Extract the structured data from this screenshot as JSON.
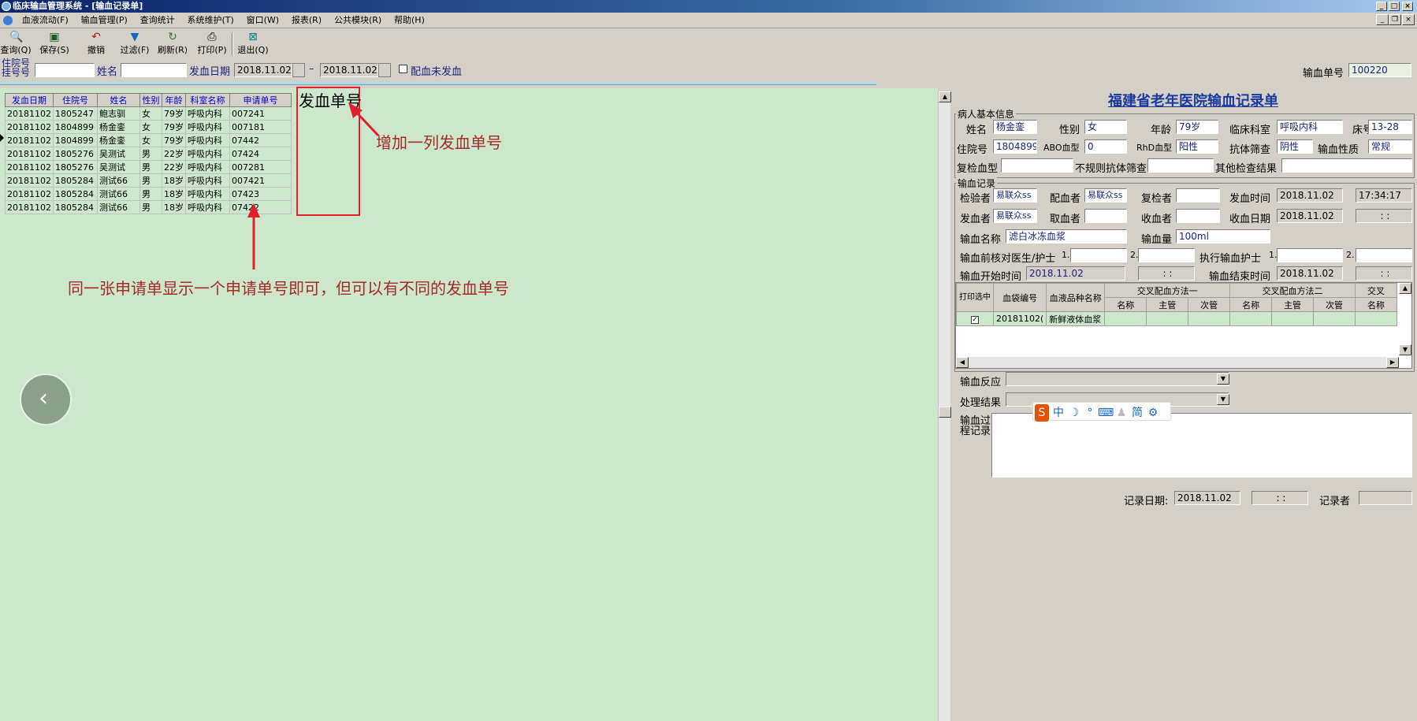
{
  "window": {
    "title": "临床输血管理系统 - [输血记录单]"
  },
  "menu": [
    "血液流动(F)",
    "输血管理(P)",
    "查询统计",
    "系统维护(T)",
    "窗口(W)",
    "报表(R)",
    "公共模块(R)",
    "帮助(H)"
  ],
  "toolbar": [
    {
      "label": "查询(Q)",
      "icon": "magnifier-icon"
    },
    {
      "label": "保存(S)",
      "icon": "save-icon"
    },
    {
      "label": "撤销",
      "icon": "undo-icon"
    },
    {
      "label": "过滤(F)",
      "icon": "filter-icon"
    },
    {
      "label": "刷新(R)",
      "icon": "refresh-icon"
    },
    {
      "label": "打印(P)",
      "icon": "printer-icon"
    },
    {
      "label": "退出(Q)",
      "icon": "exit-icon"
    }
  ],
  "search": {
    "inpatient_label_1": "住院号",
    "inpatient_label_2": "挂号号",
    "name_label": "姓名",
    "date_label": "发血日期",
    "date_from": "2018.11.02",
    "date_sep": "–",
    "date_to": "2018.11.02",
    "checkbox_label": "配血未发血",
    "order_no_label": "输血单号",
    "order_no_value": "100220"
  },
  "grid": {
    "headers": [
      "发血日期",
      "住院号",
      "姓名",
      "性别",
      "年龄",
      "科室名称",
      "申请单号"
    ],
    "rows": [
      [
        "20181102",
        "1805247",
        "鲍志驯",
        "女",
        "79岁",
        "呼吸内科",
        "007241"
      ],
      [
        "20181102",
        "1804899",
        "杨金銮",
        "女",
        "79岁",
        "呼吸内科",
        "007181"
      ],
      [
        "20181102",
        "1804899",
        "杨金銮",
        "女",
        "79岁",
        "呼吸内科",
        "07442"
      ],
      [
        "20181102",
        "1805276",
        "吴测试",
        "男",
        "22岁",
        "呼吸内科",
        "07424"
      ],
      [
        "20181102",
        "1805276",
        "吴测试",
        "男",
        "22岁",
        "呼吸内科",
        "007281"
      ],
      [
        "20181102",
        "1805284",
        "测试66",
        "男",
        "18岁",
        "呼吸内科",
        "007421"
      ],
      [
        "20181102",
        "1805284",
        "测试66",
        "男",
        "18岁",
        "呼吸内科",
        "07423"
      ],
      [
        "20181102",
        "1805284",
        "测试66",
        "男",
        "18岁",
        "呼吸内科",
        "07422"
      ]
    ]
  },
  "annotations": {
    "column_title": "发血单号",
    "add_column_note": "增加一列发血单号",
    "same_application_note": "同一张申请单显示一个申请单号即可，但可以有不同的发血单号"
  },
  "record": {
    "title": "福建省老年医院输血记录单",
    "patient_group": "病人基本信息",
    "name_label": "姓名",
    "name": "杨金銮",
    "sex_label": "性别",
    "sex": "女",
    "age_label": "年龄",
    "age": "79岁",
    "dept_label": "临床科室",
    "dept": "呼吸内科",
    "bed_label": "床号",
    "bed": "13-28",
    "inpatient_label": "住院号",
    "inpatient": "1804899",
    "abo_label": "ABO血型",
    "abo": "0",
    "rhd_label": "RhD血型",
    "rhd": "阳性",
    "antibody_label": "抗体筛查",
    "antibody": "阴性",
    "nature_label": "输血性质",
    "nature": "常规",
    "recheck_label": "复检血型",
    "recheck": "",
    "irregular_label": "不规则抗体筛查",
    "irregular": "",
    "other_label": "其他检查结果",
    "other": "",
    "record_group": "输血记录",
    "checker_label": "检验者",
    "checker": "易联众ss",
    "matcher_label": "配血者",
    "matcher": "易联众ss",
    "rechecker_label": "复检者",
    "rechecker": "",
    "issue_time_label": "发血时间",
    "issue_date": "2018.11.02",
    "issue_time": "17:34:17",
    "issuer_label": "发血者",
    "issuer": "易联众ss",
    "taker_label": "取血者",
    "taker": "",
    "receiver_label": "收血者",
    "receiver": "",
    "receive_date_label": "收血日期",
    "receive_date": "2018.11.02",
    "receive_time": ":  :",
    "blood_name_label": "输血名称",
    "blood_name": "滤白冰冻血浆",
    "amount_label": "输血量",
    "amount": "100ml",
    "precheck_label": "输血前核对医生/护士",
    "n1": "1.",
    "n2": "2.",
    "exec_nurse_label": "执行输血护士",
    "start_label": "输血开始时间",
    "start_date": "2018.11.02",
    "start_time": ":  :",
    "end_label": "输血结束时间",
    "end_date": "2018.11.02",
    "end_time": ":  :",
    "bag_headers": {
      "print": "打印选中",
      "bag_no": "血袋编号",
      "product": "血液品种名称",
      "cross1": "交叉配血方法一",
      "cross2": "交叉配血方法二",
      "cross3": "交叉",
      "name": "名称",
      "main": "主管",
      "minor": "次管"
    },
    "bag_row": {
      "bag_no": "20181102(",
      "product": "新鲜液体血浆"
    },
    "reaction_label": "输血反应",
    "reaction": "",
    "result_label": "处理结果",
    "result": "",
    "process_label": "输血过程记录",
    "record_date_label": "记录日期:",
    "record_date": "2018.11.02",
    "record_time": ":  :",
    "recorder_label": "记录者",
    "recorder": ""
  },
  "ime": [
    "中",
    "简"
  ]
}
